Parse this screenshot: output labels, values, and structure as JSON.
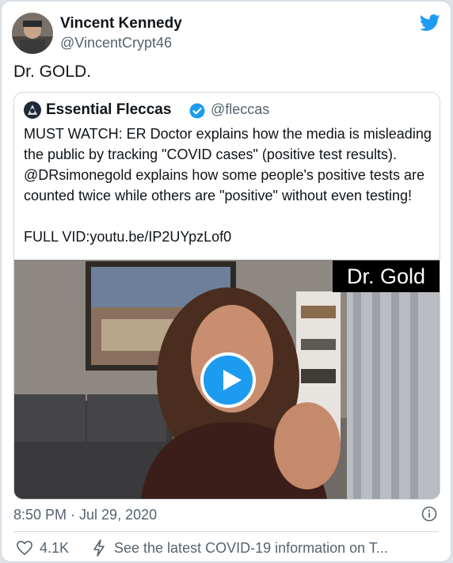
{
  "tweet": {
    "author_name": "Vincent Kennedy",
    "author_handle": "@VincentCrypt46",
    "text": "Dr. GOLD.",
    "timestamp": "8:50 PM · Jul 29, 2020",
    "likes": "4.1K",
    "covid_notice": "See the latest COVID-19 information on T..."
  },
  "quoted": {
    "author_name": "Essential Fleccas",
    "author_handle": "@fleccas",
    "body": "MUST WATCH: ER Doctor explains how the media is misleading the public by tracking \"COVID cases\" (positive test results). @DRsimonegold explains how some people's positive tests are counted twice while others are \"positive\" without even testing!\n\nFULL VID:youtu.be/IP2UYpzLof0",
    "video_caption": "Dr. Gold"
  },
  "colors": {
    "accent": "#1d9bf0",
    "text": "#0f1419",
    "muted": "#536471"
  },
  "icons": [
    "twitter-bird-icon",
    "verified-badge-icon",
    "play-icon",
    "info-icon",
    "heart-icon",
    "lightning-bolt-icon"
  ]
}
